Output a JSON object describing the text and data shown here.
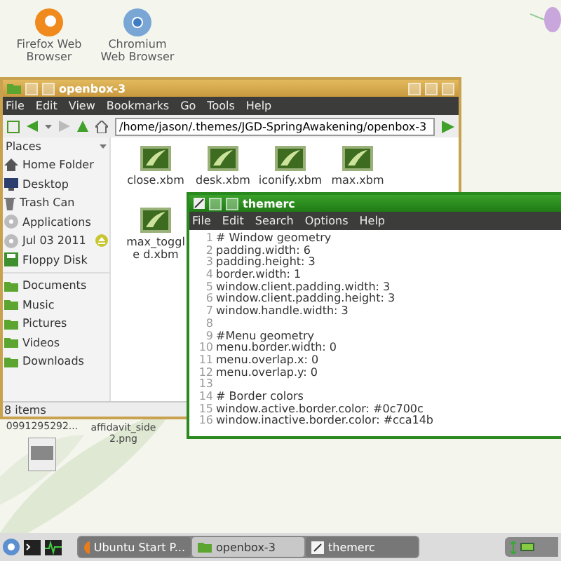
{
  "desktop_icons": [
    {
      "label": "Firefox Web Browser",
      "kind": "firefox"
    },
    {
      "label": "Chromium Web Browser",
      "kind": "chromium"
    }
  ],
  "desktop_files": [
    {
      "label": "0991295292...",
      "kind": "image"
    },
    {
      "label": "affidavit_side 2.png",
      "kind": "none"
    }
  ],
  "file_manager": {
    "title": "openbox-3",
    "menu": [
      "File",
      "Edit",
      "View",
      "Bookmarks",
      "Go",
      "Tools",
      "Help"
    ],
    "path": "/home/jason/.themes/JGD-SpringAwakening/openbox-3",
    "places_label": "Places",
    "places": [
      {
        "label": "Home Folder",
        "kind": "home",
        "ejectable": false
      },
      {
        "label": "Desktop",
        "kind": "desktop",
        "ejectable": false
      },
      {
        "label": "Trash Can",
        "kind": "trash",
        "ejectable": false
      },
      {
        "label": "Applications",
        "kind": "disc",
        "ejectable": false
      },
      {
        "label": "Jul 03 2011",
        "kind": "disc",
        "ejectable": true
      },
      {
        "label": "Floppy Disk",
        "kind": "floppy",
        "ejectable": false
      }
    ],
    "bookmarks": [
      {
        "label": "Documents"
      },
      {
        "label": "Music"
      },
      {
        "label": "Pictures"
      },
      {
        "label": "Videos"
      },
      {
        "label": "Downloads"
      }
    ],
    "files": [
      {
        "name": "close.xbm"
      },
      {
        "name": "desk.xbm"
      },
      {
        "name": "iconify.xbm"
      },
      {
        "name": "max.xbm"
      },
      {
        "name": "max_toggle d.xbm"
      }
    ],
    "status": "8 items"
  },
  "editor": {
    "title": "themerc",
    "menu": [
      "File",
      "Edit",
      "Search",
      "Options",
      "Help"
    ],
    "lines": [
      {
        "number": "1",
        "text": "# Window geometry"
      },
      {
        "number": "2",
        "text": "padding.width: 6"
      },
      {
        "number": "3",
        "text": "padding.height: 3"
      },
      {
        "number": "4",
        "text": "border.width: 1"
      },
      {
        "number": "5",
        "text": "window.client.padding.width: 3"
      },
      {
        "number": "6",
        "text": "window.client.padding.height: 3"
      },
      {
        "number": "7",
        "text": "window.handle.width: 3"
      },
      {
        "number": "8"
      },
      {
        "number": "9",
        "text": "#Menu geometry"
      },
      {
        "number": "10",
        "text": "menu.border.width: 0"
      },
      {
        "number": "11",
        "text": "menu.overlap.x: 0"
      },
      {
        "number": "12",
        "text": "menu.overlap.y: 0"
      },
      {
        "number": "13"
      },
      {
        "number": "14",
        "text": "# Border colors"
      },
      {
        "number": "15",
        "text": "window.active.border.color: #0c700c"
      },
      {
        "number": "16",
        "text": "window.inactive.border.color: #cca14b"
      }
    ]
  },
  "taskbar": {
    "tasks": [
      {
        "label": "Ubuntu Start P...",
        "kind": "browser",
        "selected": false
      },
      {
        "label": "openbox-3",
        "kind": "folder",
        "selected": true
      },
      {
        "label": "themerc",
        "kind": "editor",
        "selected": false
      }
    ]
  }
}
